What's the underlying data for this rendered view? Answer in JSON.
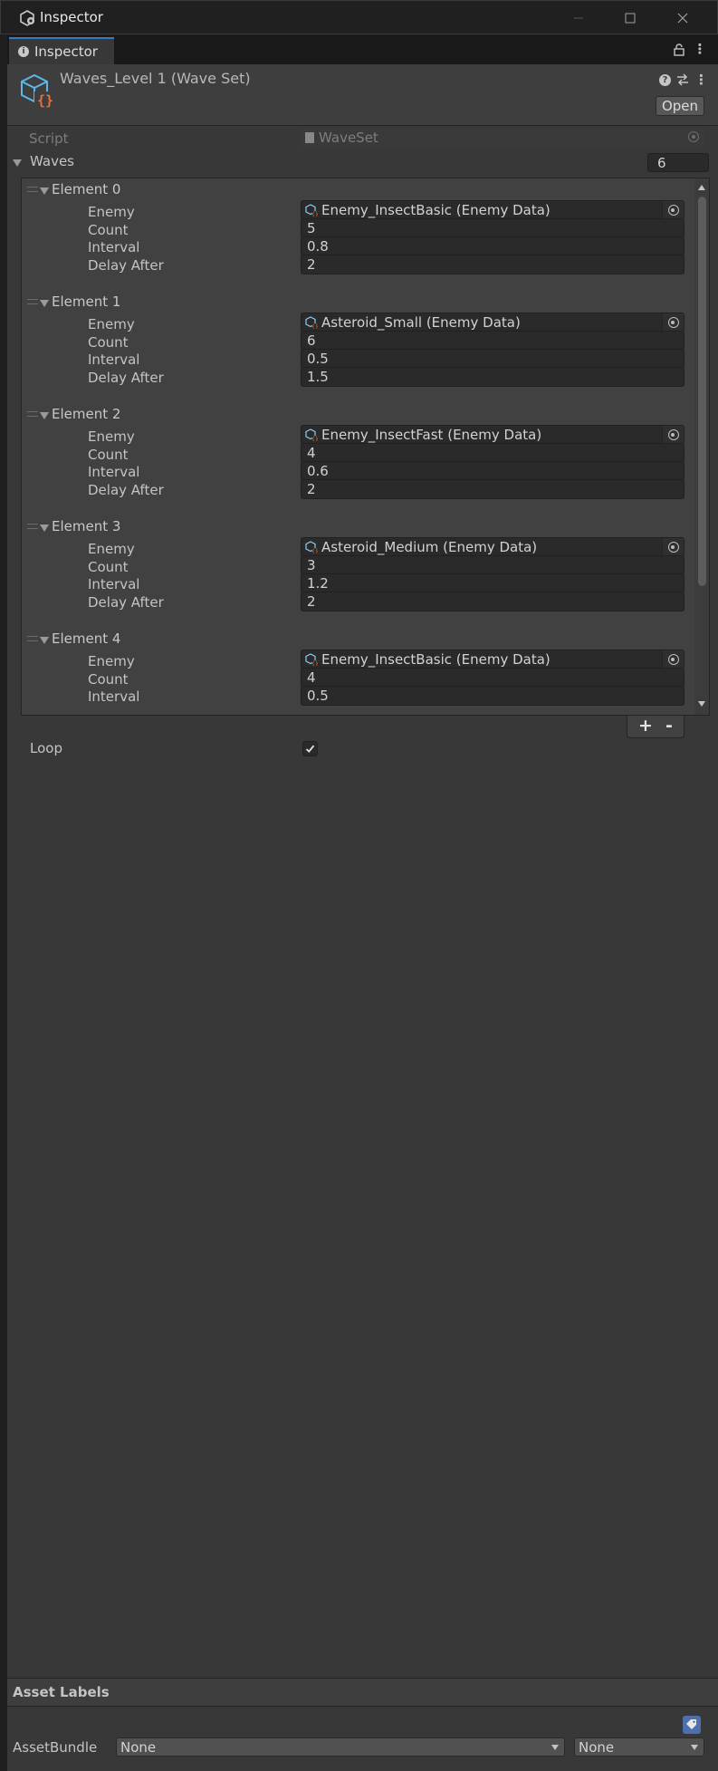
{
  "window": {
    "title": "Inspector"
  },
  "tab": {
    "label": "Inspector"
  },
  "header": {
    "asset_title": "Waves_Level 1 (Wave Set)",
    "open_label": "Open"
  },
  "script": {
    "label": "Script",
    "value": "WaveSet"
  },
  "waves": {
    "label": "Waves",
    "count": "6",
    "elements": [
      {
        "label": "Element 0",
        "enemy": "Enemy_InsectBasic (Enemy Data)",
        "count": "5",
        "interval": "0.8",
        "delay_after": "2"
      },
      {
        "label": "Element 1",
        "enemy": "Asteroid_Small (Enemy Data)",
        "count": "6",
        "interval": "0.5",
        "delay_after": "1.5"
      },
      {
        "label": "Element 2",
        "enemy": "Enemy_InsectFast (Enemy Data)",
        "count": "4",
        "interval": "0.6",
        "delay_after": "2"
      },
      {
        "label": "Element 3",
        "enemy": "Asteroid_Medium (Enemy Data)",
        "count": "3",
        "interval": "1.2",
        "delay_after": "2"
      },
      {
        "label": "Element 4",
        "enemy": "Enemy_InsectBasic (Enemy Data)",
        "count": "4",
        "interval": "0.5",
        "delay_after": ""
      }
    ],
    "prop_labels": {
      "enemy": "Enemy",
      "count": "Count",
      "interval": "Interval",
      "delay_after": "Delay After"
    },
    "add_label": "+",
    "remove_label": "-"
  },
  "loop": {
    "label": "Loop",
    "checked": true
  },
  "asset_labels": {
    "title": "Asset Labels"
  },
  "asset_bundle": {
    "label": "AssetBundle",
    "name_value": "None",
    "variant_value": "None"
  },
  "colors": {
    "accent": "#3a79bb",
    "asset_icon": "#5bb8e8",
    "asset_badge": "#e8703a"
  }
}
